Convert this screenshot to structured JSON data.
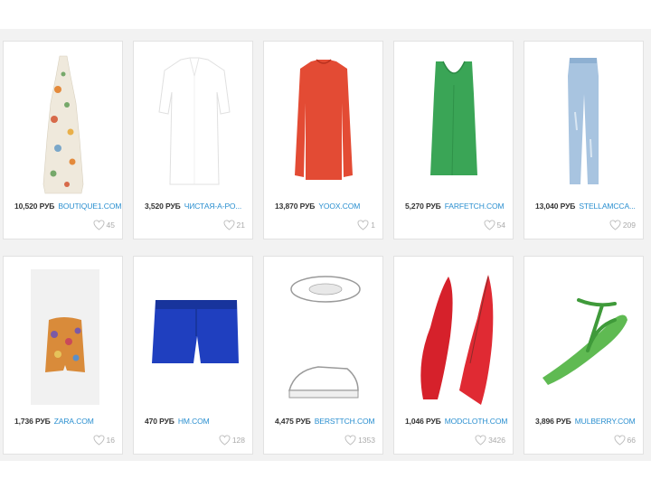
{
  "items": [
    {
      "price": "10,520 РУБ",
      "store": "BOUTIQUE1.COM",
      "likes": "45",
      "image": "floral-halter-maxi-dress"
    },
    {
      "price": "3,520 РУБ",
      "store": "ЧИСТАЯ-А-РО...",
      "likes": "21",
      "image": "white-tunic-shirt"
    },
    {
      "price": "13,870 РУБ",
      "store": "YOOX.COM",
      "likes": "1",
      "image": "red-long-sweater"
    },
    {
      "price": "5,270 РУБ",
      "store": "FARFETCH.COM",
      "likes": "54",
      "image": "green-sleeveless-top"
    },
    {
      "price": "13,040 РУБ",
      "store": "STELLAMCCA...",
      "likes": "209",
      "image": "light-blue-jeans"
    },
    {
      "price": "1,736 РУБ",
      "store": "ZARA.COM",
      "likes": "16",
      "image": "printed-shorts"
    },
    {
      "price": "470 РУБ",
      "store": "HM.COM",
      "likes": "128",
      "image": "blue-denim-shorts"
    },
    {
      "price": "4,475 РУБ",
      "store": "BERSTTCH.COM",
      "likes": "1353",
      "image": "white-canvas-sneakers"
    },
    {
      "price": "1,046 РУБ",
      "store": "MODCLOTH.COM",
      "likes": "3426",
      "image": "red-ballet-flats"
    },
    {
      "price": "3,896 РУБ",
      "store": "MULBERRY.COM",
      "likes": "66",
      "image": "green-t-strap-sandal"
    }
  ],
  "colors": {
    "price": "#333333",
    "store_link": "#2a8fd0",
    "likes": "#aaaaaa",
    "background": "#f2f2f2"
  },
  "icons": {
    "like": "heart-icon"
  }
}
